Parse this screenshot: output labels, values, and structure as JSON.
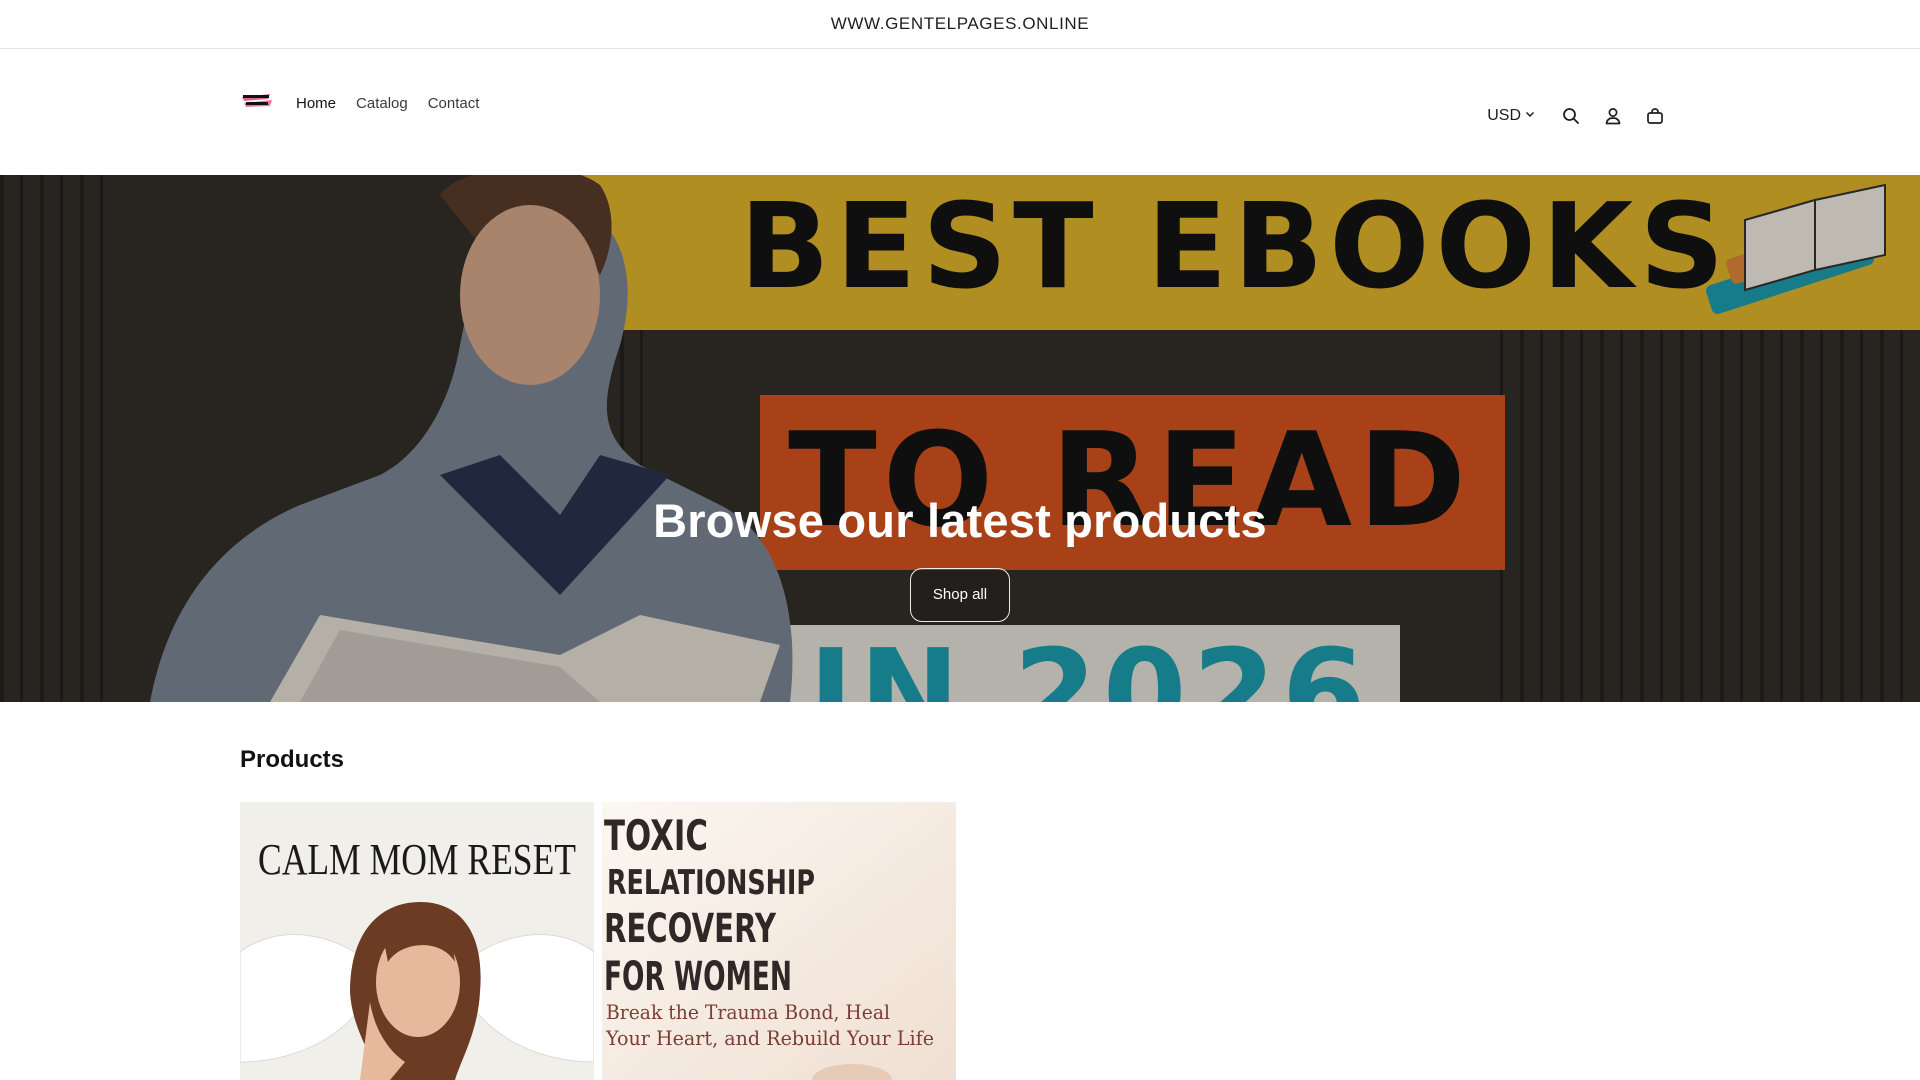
{
  "announcement": {
    "text": "WWW.GENTELPAGES.ONLINE"
  },
  "header": {
    "logo_alt": "GENTEL PAGES",
    "nav": [
      {
        "label": "Home",
        "active": true
      },
      {
        "label": "Catalog",
        "active": false
      },
      {
        "label": "Contact",
        "active": false
      }
    ],
    "currency": "USD",
    "icons": [
      "chevron-down-icon",
      "search-icon",
      "account-icon",
      "cart-icon"
    ]
  },
  "hero": {
    "banner_lines": [
      "BEST EBOOKS",
      "TO READ",
      "IN 2026"
    ],
    "title": "Browse our latest products",
    "button_label": "Shop all",
    "colors": {
      "yellow_band": "#e2b62c",
      "orange_band": "#d9541f",
      "teal": "#1e9fb0"
    }
  },
  "products": {
    "section_title": "Products",
    "items": [
      {
        "cover_title": "CALM MOM RESET"
      },
      {
        "cover_title_lines": [
          "TOXIC",
          "RELATIONSHIP",
          "RECOVERY",
          "FOR WOMEN"
        ],
        "cover_subtitle_lines": [
          "Break the Trauma Bond, Heal",
          "Your Heart, and Rebuild Your Life"
        ]
      }
    ]
  }
}
